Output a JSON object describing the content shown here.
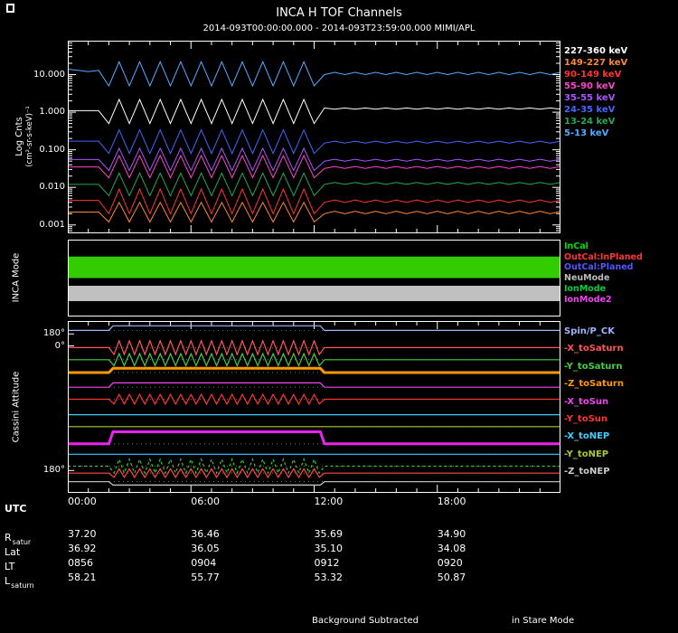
{
  "header": {
    "title": "INCA H TOF Channels",
    "subtitle": "2014-093T00:00:00.000 - 2014-093T23:59:00.000 MIMI/APL"
  },
  "spectra_panel": {
    "ylabel1": "Log Cnts",
    "ylabel2": "(cm²-sr-s-keV)⁻¹",
    "yticks": [
      "10.000",
      "1.000",
      "0.100",
      "0.010",
      "0.001"
    ]
  },
  "mode_panel": {
    "label": "INCA Mode"
  },
  "attitude_panel": {
    "label": "Cassini Attitude",
    "yticks": [
      "180°",
      "0°",
      "180°"
    ]
  },
  "xaxis": {
    "label": "UTC",
    "ticks": [
      "00:00",
      "06:00",
      "12:00",
      "18:00"
    ],
    "tick_hours": [
      0,
      6,
      12,
      18
    ]
  },
  "info_rows": [
    {
      "label": "R",
      "sub": "satur",
      "values": [
        "37.20",
        "36.46",
        "35.69",
        "34.90"
      ]
    },
    {
      "label": "Lat",
      "sub": "",
      "values": [
        "36.92",
        "36.05",
        "35.10",
        "34.08"
      ]
    },
    {
      "label": "LT",
      "sub": "",
      "values": [
        "0856",
        "0904",
        "0912",
        "0920"
      ]
    },
    {
      "label": "L",
      "sub": "saturn",
      "values": [
        "58.21",
        "55.77",
        "53.32",
        "50.87"
      ]
    }
  ],
  "footer": {
    "left": "Background Subtracted",
    "right": "in Stare Mode"
  },
  "chart_data": [
    {
      "id": "spectra",
      "type": "line",
      "title": "INCA H TOF Channels",
      "subtitle": "2014-093T00:00:00.000 - 2014-093T23:59:00.000 MIMI/APL",
      "ylabel": "Log Cnts (cm2-sr-s-keV)-1",
      "yscale": "log",
      "ytick_values": [
        10,
        1,
        0.1,
        0.01,
        0.001
      ],
      "x_range_hours": [
        0,
        24
      ],
      "x_hours_step": 0.5,
      "series": [
        {
          "name": "227-360 keV",
          "color": "#ffffff",
          "values": [
            1.1,
            1.1,
            1.1,
            1.1,
            0.5,
            2.2,
            0.5,
            2.2,
            0.5,
            2.2,
            0.5,
            2.2,
            0.5,
            2.2,
            0.5,
            2.2,
            0.5,
            2.2,
            0.5,
            2.2,
            0.5,
            2.2,
            0.5,
            2.2,
            0.5,
            1.3,
            1.2,
            1.3,
            1.2,
            1.3,
            1.2,
            1.3,
            1.2,
            1.3,
            1.2,
            1.3,
            1.2,
            1.3,
            1.2,
            1.3,
            1.2,
            1.3,
            1.2,
            1.3,
            1.2,
            1.3,
            1.2,
            1.3,
            1.2
          ]
        },
        {
          "name": "149-227 keV",
          "color": "#ff8833",
          "values": [
            0.0022,
            0.0022,
            0.0022,
            0.0022,
            0.0012,
            0.004,
            0.0012,
            0.004,
            0.0012,
            0.004,
            0.0012,
            0.004,
            0.0012,
            0.004,
            0.0012,
            0.004,
            0.0012,
            0.004,
            0.0012,
            0.004,
            0.0012,
            0.004,
            0.0012,
            0.004,
            0.0012,
            0.002,
            0.0023,
            0.002,
            0.0023,
            0.002,
            0.0023,
            0.002,
            0.0023,
            0.002,
            0.0023,
            0.002,
            0.0023,
            0.002,
            0.0023,
            0.002,
            0.0023,
            0.002,
            0.0023,
            0.002,
            0.0023,
            0.002,
            0.0023,
            0.002,
            0.0023
          ]
        },
        {
          "name": "90-149 keV",
          "color": "#ff3333",
          "values": [
            0.0045,
            0.0045,
            0.0045,
            0.0045,
            0.002,
            0.009,
            0.002,
            0.009,
            0.002,
            0.009,
            0.002,
            0.009,
            0.002,
            0.009,
            0.002,
            0.009,
            0.002,
            0.009,
            0.002,
            0.009,
            0.002,
            0.009,
            0.002,
            0.009,
            0.002,
            0.004,
            0.0046,
            0.004,
            0.0046,
            0.004,
            0.0046,
            0.004,
            0.0046,
            0.004,
            0.0046,
            0.004,
            0.0046,
            0.004,
            0.0046,
            0.004,
            0.0046,
            0.004,
            0.0046,
            0.004,
            0.0046,
            0.004,
            0.0046,
            0.004,
            0.0046
          ]
        },
        {
          "name": "55-90 keV",
          "color": "#ff44cc",
          "values": [
            0.035,
            0.035,
            0.035,
            0.035,
            0.018,
            0.07,
            0.018,
            0.07,
            0.018,
            0.07,
            0.018,
            0.07,
            0.018,
            0.07,
            0.018,
            0.07,
            0.018,
            0.07,
            0.018,
            0.07,
            0.018,
            0.07,
            0.018,
            0.07,
            0.018,
            0.032,
            0.036,
            0.032,
            0.036,
            0.032,
            0.036,
            0.032,
            0.036,
            0.032,
            0.036,
            0.032,
            0.036,
            0.032,
            0.036,
            0.032,
            0.036,
            0.032,
            0.036,
            0.032,
            0.036,
            0.032,
            0.036,
            0.032,
            0.036
          ]
        },
        {
          "name": "35-55 keV",
          "color": "#aa55ff",
          "values": [
            0.055,
            0.055,
            0.055,
            0.055,
            0.028,
            0.11,
            0.028,
            0.11,
            0.028,
            0.11,
            0.028,
            0.11,
            0.028,
            0.11,
            0.028,
            0.11,
            0.028,
            0.11,
            0.028,
            0.11,
            0.028,
            0.11,
            0.028,
            0.11,
            0.028,
            0.05,
            0.056,
            0.05,
            0.056,
            0.05,
            0.056,
            0.05,
            0.056,
            0.05,
            0.056,
            0.05,
            0.056,
            0.05,
            0.056,
            0.05,
            0.056,
            0.05,
            0.056,
            0.05,
            0.056,
            0.05,
            0.056,
            0.05,
            0.056
          ]
        },
        {
          "name": "24-35 keV",
          "color": "#4466ff",
          "values": [
            0.17,
            0.17,
            0.17,
            0.17,
            0.08,
            0.34,
            0.08,
            0.34,
            0.08,
            0.34,
            0.08,
            0.34,
            0.08,
            0.34,
            0.08,
            0.34,
            0.08,
            0.34,
            0.08,
            0.34,
            0.08,
            0.34,
            0.08,
            0.34,
            0.08,
            0.15,
            0.17,
            0.15,
            0.17,
            0.15,
            0.17,
            0.15,
            0.17,
            0.15,
            0.17,
            0.15,
            0.17,
            0.15,
            0.17,
            0.15,
            0.17,
            0.15,
            0.17,
            0.15,
            0.17,
            0.15,
            0.17,
            0.15,
            0.17
          ]
        },
        {
          "name": "13-24 keV",
          "color": "#22aa55",
          "values": [
            0.012,
            0.012,
            0.012,
            0.012,
            0.006,
            0.024,
            0.006,
            0.024,
            0.006,
            0.024,
            0.006,
            0.024,
            0.006,
            0.024,
            0.006,
            0.024,
            0.006,
            0.024,
            0.006,
            0.024,
            0.006,
            0.024,
            0.006,
            0.024,
            0.006,
            0.012,
            0.0135,
            0.012,
            0.0135,
            0.012,
            0.0135,
            0.012,
            0.0135,
            0.012,
            0.0135,
            0.012,
            0.0135,
            0.012,
            0.0135,
            0.012,
            0.0135,
            0.012,
            0.0135,
            0.012,
            0.0135,
            0.012,
            0.0135,
            0.012,
            0.0135
          ]
        },
        {
          "name": "5-13 keV",
          "color": "#55aaff",
          "values": [
            14,
            13,
            12,
            13,
            5,
            22,
            5,
            22,
            5,
            22,
            5,
            22,
            5,
            22,
            5,
            22,
            5,
            22,
            5,
            22,
            5,
            22,
            5,
            22,
            5,
            10,
            11.5,
            10,
            11.5,
            10,
            11.5,
            10,
            11.5,
            10,
            11.5,
            10,
            11.5,
            10,
            11.5,
            10,
            11.5,
            10,
            11.5,
            10,
            11.5,
            10,
            11.5,
            10,
            11.5
          ]
        }
      ]
    },
    {
      "id": "inca-mode",
      "type": "timeline",
      "label": "INCA Mode",
      "legend": [
        {
          "label": "InCal",
          "color": "#00dd00"
        },
        {
          "label": "OutCal:InPlaned",
          "color": "#ff3333"
        },
        {
          "label": "OutCal:Planed",
          "color": "#5555ff"
        },
        {
          "label": "NeuMode",
          "color": "#bbbbbb"
        },
        {
          "label": "IonMode",
          "color": "#00cc44"
        },
        {
          "label": "IonMode2",
          "color": "#ee44ee"
        }
      ],
      "bars": [
        {
          "mode": "IonMode",
          "color": "#33cc00",
          "t0_h": 0,
          "t1_h": 24,
          "y0": 0.22,
          "y1": 0.5
        },
        {
          "mode": "NeuMode",
          "color": "#c0c0c0",
          "t0_h": 0,
          "t1_h": 24,
          "y0": 0.6,
          "y1": 0.8
        }
      ]
    },
    {
      "id": "attitude",
      "type": "line",
      "label": "Cassini Attitude",
      "yticks_deg": [
        "180",
        "0",
        "180"
      ],
      "window_hours": [
        2,
        12.5
      ],
      "series": [
        {
          "name": "Spin/P_CK",
          "color": "#9fb4ff",
          "base": 0.055,
          "window": {
            "type": "step",
            "level": 0.028
          }
        },
        {
          "name": "-X_toSaturn",
          "color": "#ff5555",
          "base": 0.155,
          "window": {
            "type": "osc",
            "amp": 0.04
          }
        },
        {
          "name": "-Y_toSaturn",
          "color": "#44cc44",
          "base": 0.225,
          "window": {
            "type": "osc",
            "amp": 0.035
          }
        },
        {
          "name": "-Z_toSaturn",
          "color": "#ff9900",
          "base": 0.3,
          "width": 3,
          "window": {
            "type": "step",
            "level": 0.275
          }
        },
        {
          "name": "-X_toSun",
          "color": "#ee44ee",
          "base": 0.385,
          "window": {
            "type": "step",
            "level": 0.36
          }
        },
        {
          "name": "-Y_toSun",
          "color": "#ff3333",
          "base": 0.455,
          "window": {
            "type": "osc",
            "amp": 0.028
          }
        },
        {
          "name": "-X_toNEP",
          "color": "#44ccff",
          "base": 0.545,
          "window": {
            "type": "flat"
          }
        },
        {
          "name": "-Y_toNEP",
          "color": "#a8c832",
          "base": 0.615,
          "window": {
            "type": "flat"
          }
        },
        {
          "name": "",
          "color": "#ee22ee",
          "base": 0.715,
          "width": 3,
          "window": {
            "type": "step",
            "level": 0.645
          }
        },
        {
          "name": "",
          "color": "#33ccff",
          "base": 0.775,
          "window": {
            "type": "flat"
          }
        },
        {
          "name": "",
          "color": "#33cc33",
          "base": 0.845,
          "dash": true,
          "window": {
            "type": "osc",
            "amp": 0.04
          }
        },
        {
          "name": "",
          "color": "#ff4444",
          "base": 0.885,
          "window": {
            "type": "osc",
            "amp": 0.025
          }
        },
        {
          "name": "-Z_toNEP",
          "color": "#cccccc",
          "base": 0.935,
          "window": {
            "type": "step",
            "level": 0.955
          }
        }
      ]
    }
  ]
}
